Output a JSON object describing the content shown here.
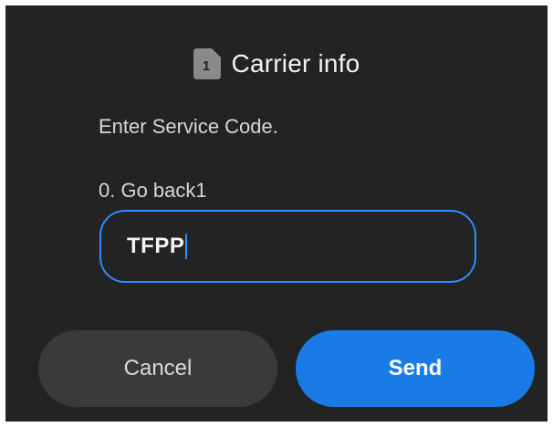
{
  "dialog": {
    "sim_badge": "1",
    "title": "Carrier info",
    "message": "Enter Service Code.",
    "option_text": "0. Go back1",
    "input": {
      "value": "TFPP"
    },
    "buttons": {
      "cancel_label": "Cancel",
      "send_label": "Send"
    }
  },
  "colors": {
    "dialog_background": "#232323",
    "accent": "#2f8cff",
    "send_button": "#1a7be6",
    "cancel_button": "#3a3a3a"
  },
  "icons": {
    "title_icon": "sim-card-icon"
  }
}
